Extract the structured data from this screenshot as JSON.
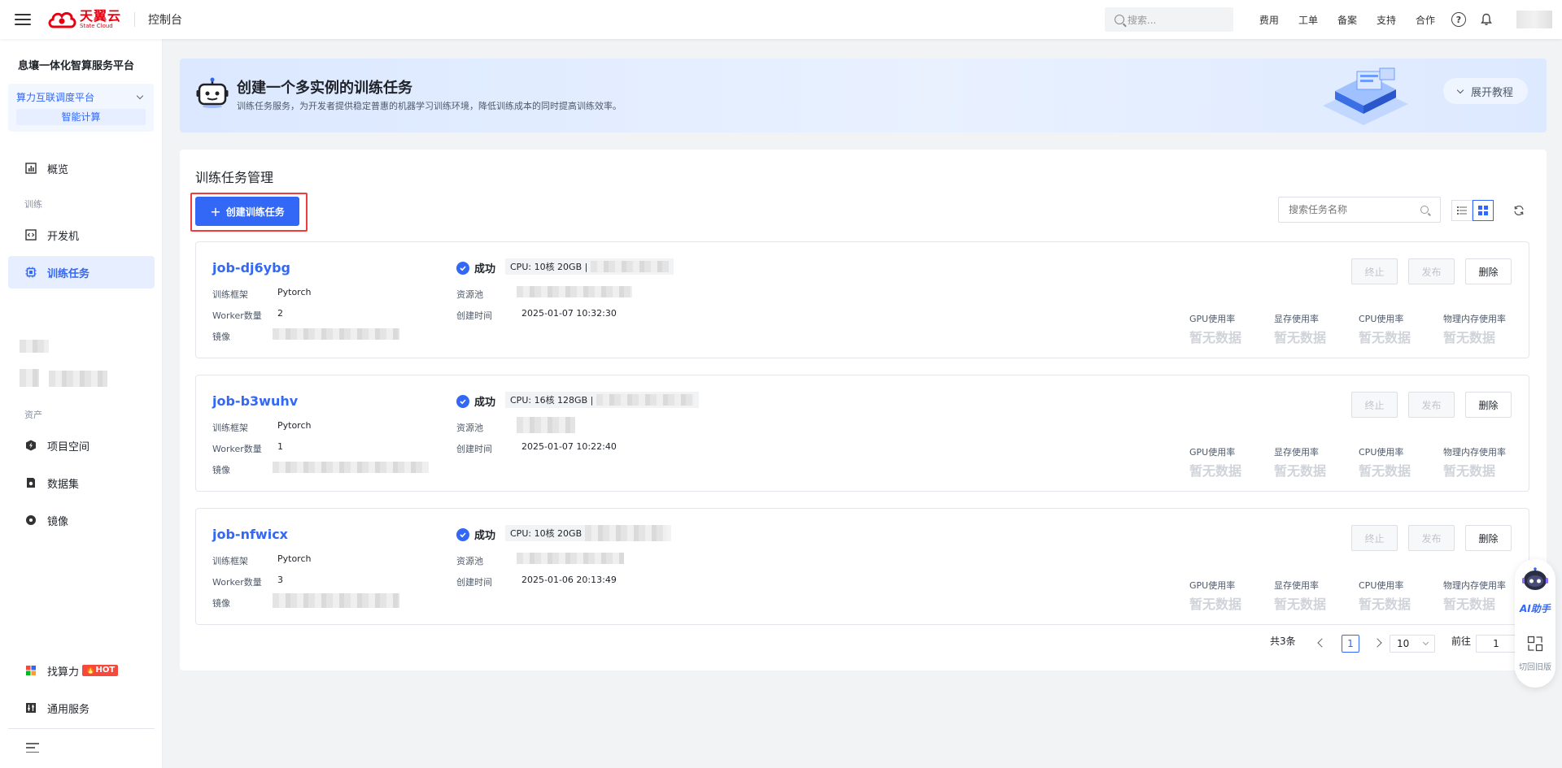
{
  "topbar": {
    "logo_cn": "天翼云",
    "logo_en": "State Cloud",
    "console": "控制台",
    "search_placeholder": "搜索...",
    "links": [
      "费用",
      "工单",
      "备案",
      "支持",
      "合作"
    ]
  },
  "sidebar": {
    "platform_title": "息壤一体化智算服务平台",
    "platform_select": "算力互联调度平台",
    "platform_sub": "智能计算",
    "items": [
      {
        "label": "概览"
      },
      {
        "group": "训练"
      },
      {
        "label": "开发机"
      },
      {
        "label": "训练任务"
      },
      {
        "group": "资产"
      },
      {
        "label": "项目空间"
      },
      {
        "label": "数据集"
      },
      {
        "label": "镜像"
      },
      {
        "label": "找算力",
        "badge": "HOT"
      },
      {
        "label": "通用服务"
      }
    ]
  },
  "banner": {
    "title": "创建一个多实例的训练任务",
    "desc": "训练任务服务，为开发者提供稳定普惠的机器学习训练环境，降低训练成本的同时提高训练效率。",
    "expand": "展开教程"
  },
  "panel": {
    "title": "训练任务管理",
    "create_button": "创建训练任务",
    "search_placeholder": "搜索任务名称"
  },
  "labels": {
    "framework": "训练框架",
    "workers": "Worker数量",
    "image": "镜像",
    "pool": "资源池",
    "created": "创建时间",
    "stop": "终止",
    "publish": "发布",
    "delete": "删除",
    "gpu": "GPU使用率",
    "vram": "显存使用率",
    "cpu": "CPU使用率",
    "mem": "物理内存使用率",
    "no_data": "暂无数据"
  },
  "tasks": [
    {
      "name": "job-dj6ybg",
      "status": "成功",
      "spec": "CPU: 10核 20GB |",
      "framework": "Pytorch",
      "workers": "2",
      "created": "2025-01-07 10:32:30"
    },
    {
      "name": "job-b3wuhv",
      "status": "成功",
      "spec": "CPU: 16核 128GB |",
      "framework": "Pytorch",
      "workers": "1",
      "created": "2025-01-07 10:22:40"
    },
    {
      "name": "job-nfwicx",
      "status": "成功",
      "spec": "CPU: 10核 20GB",
      "framework": "Pytorch",
      "workers": "3",
      "created": "2025-01-06 20:13:49"
    }
  ],
  "pagination": {
    "total": "共3条",
    "current": "1",
    "page_size": "10",
    "goto_label": "前往",
    "goto_value": "1"
  },
  "float": {
    "ai": "AI助手",
    "switch": "切回旧版"
  },
  "colors": {
    "primary": "#3367f5",
    "brand_red": "#e60012",
    "highlight": "#f03c3c"
  }
}
